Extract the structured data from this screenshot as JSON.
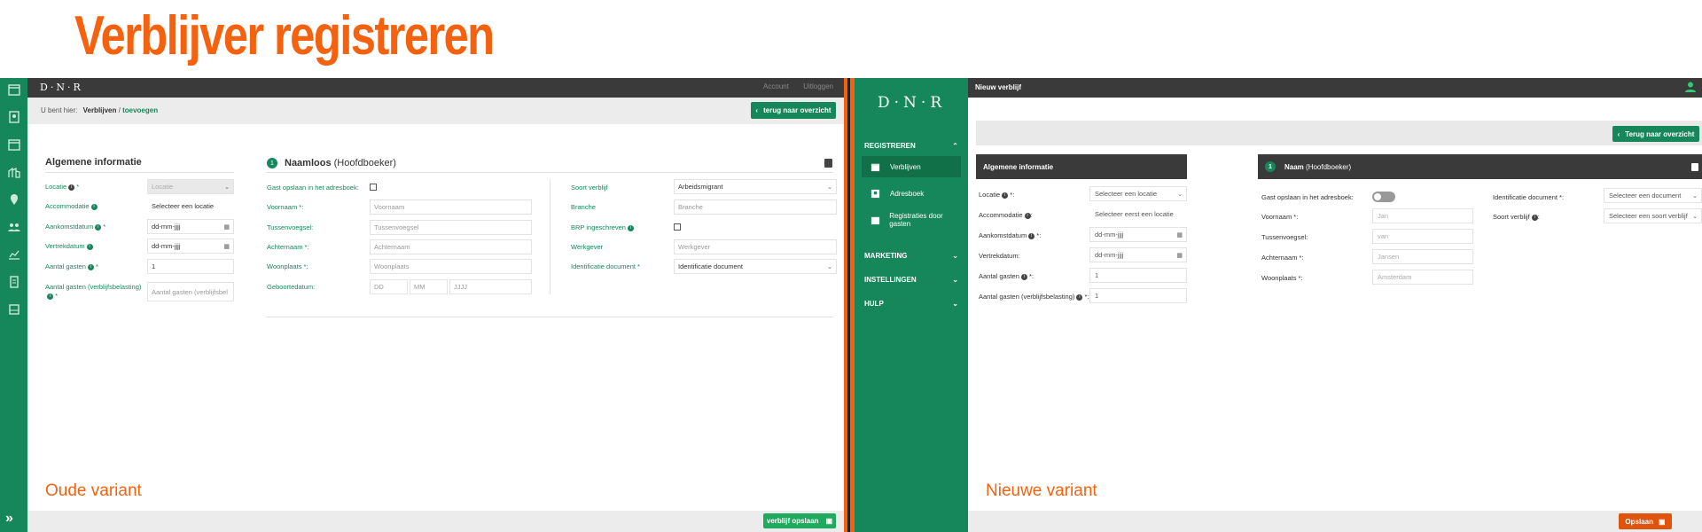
{
  "page_title": "Verblijver registreren",
  "old": {
    "variant_label": "Oude variant",
    "logo": "D·N·R",
    "top_links": [
      "Account",
      "Uitloggen"
    ],
    "breadcrumb": {
      "prefix": "U bent hier:",
      "item1": "Verblijven",
      "sep": "/",
      "item2": "toevoegen"
    },
    "back_button": "terug naar overzicht",
    "general": {
      "title": "Algemene informatie",
      "fields": [
        {
          "label": "Locatie",
          "req": " *",
          "value": "Locatie"
        },
        {
          "label": "Accommodatie",
          "req": "",
          "value": "Selecteer een locatie"
        },
        {
          "label": "Aankomstdatum",
          "req": " *",
          "value": "dd-mm-jjjj"
        },
        {
          "label": "Vertrekdatum",
          "req": "",
          "value": "dd-mm-jjjj"
        },
        {
          "label": "Aantal gasten",
          "req": " *",
          "value": "1"
        },
        {
          "label": "Aantal gasten (verblijfsbelasting)",
          "req": " *",
          "value": "Aantal gasten (verblijfsbel"
        }
      ]
    },
    "guest": {
      "number": "1",
      "name": "Naamloos",
      "role": "(Hoofdboeker)",
      "left_fields": [
        {
          "label": "Gast opslaan in het adresboek:",
          "value": ""
        },
        {
          "label": "Voornaam *:",
          "value": "Voornaam"
        },
        {
          "label": "Tussenvoegsel:",
          "value": "Tussenvoegsel"
        },
        {
          "label": "Achternaam *:",
          "value": "Achternaam"
        },
        {
          "label": "Woonplaats *:",
          "value": "Woonplaats"
        },
        {
          "label": "Geboortedatum:",
          "value": ""
        }
      ],
      "birth_parts": [
        "DD",
        "MM",
        "JJJJ"
      ],
      "right_fields": [
        {
          "label": "Soort verblijf",
          "value": "Arbeidsmigrant"
        },
        {
          "label": "Branche",
          "value": "Branche"
        },
        {
          "label": "BRP ingeschreven",
          "value": ""
        },
        {
          "label": "Werkgever",
          "value": "Werkgever"
        },
        {
          "label": "Identificatie document *",
          "value": "Identificatie document"
        }
      ]
    },
    "save_button": "verblijf opslaan"
  },
  "new": {
    "variant_label": "Nieuwe variant",
    "logo": "D·N·R",
    "top_title": "Nieuw verblijf",
    "sidebar": {
      "sections": [
        "REGISTREREN",
        "MARKETING",
        "INSTELLINGEN",
        "HULP"
      ],
      "items": [
        "Verblijven",
        "Adresboek",
        "Registraties door gasten"
      ]
    },
    "back_button": "Terug naar overzicht",
    "general": {
      "title": "Algemene informatie",
      "fields": [
        {
          "label": "Locatie",
          "suffix": " *:",
          "value": "Selecteer een locatie"
        },
        {
          "label": "Accommodatie",
          "suffix": ":",
          "value": "Selecteer eerst een locatie"
        },
        {
          "label": "Aankomstdatum",
          "suffix": " *:",
          "value": "dd-mm-jjjj"
        },
        {
          "label": "Vertrekdatum",
          "suffix": ":",
          "value": "dd-mm-jjjj"
        },
        {
          "label": "Aantal gasten",
          "suffix": " *:",
          "value": "1"
        },
        {
          "label": "Aantal gasten (verblijfsbelasting)",
          "suffix": " *:",
          "value": "1"
        }
      ]
    },
    "guest": {
      "number": "1",
      "name": "Naam",
      "role": "(Hoofdboeker)",
      "left_fields": [
        {
          "label": "Gast opslaan in het adresboek:",
          "value": ""
        },
        {
          "label": "Voornaam *:",
          "value": "Jan"
        },
        {
          "label": "Tussenvoegsel:",
          "value": "van"
        },
        {
          "label": "Achternaam *:",
          "value": "Jansen"
        },
        {
          "label": "Woonplaats *:",
          "value": "Amsterdam"
        }
      ],
      "right_fields": [
        {
          "label": "Identificatie document *:",
          "value": "Selecteer een document"
        },
        {
          "label": "Soort verblijf",
          "suffix": ":",
          "value": "Selecteer een soort verblijf"
        }
      ]
    },
    "save_button": "Opslaan"
  },
  "colors": {
    "brand_green": "#16875a",
    "accent_orange": "#f5620f",
    "dark_bar": "#3a3a3a"
  }
}
